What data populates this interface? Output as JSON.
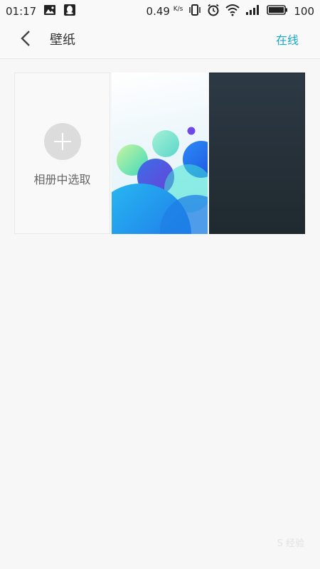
{
  "status_bar": {
    "time": "01:17",
    "speed_value": "0.49",
    "speed_unit": "K/s",
    "battery": "100",
    "icons_left": [
      "image-icon",
      "qq-notification-icon"
    ],
    "icons_right": [
      "vibrate-icon",
      "alarm-icon",
      "wifi-icon",
      "signal-icon",
      "battery-icon"
    ]
  },
  "app_bar": {
    "back_icon": "chevron-left-icon",
    "title": "壁纸",
    "action_label": "在线",
    "action_color": "#18a9c4"
  },
  "wallpapers": {
    "picker_label": "相册中选取",
    "picker_icon": "plus-icon",
    "items": [
      {
        "name": "bubbles-wallpaper",
        "style": "colorful-bubbles"
      },
      {
        "name": "dark-wallpaper",
        "style": "dark-slate"
      }
    ]
  },
  "watermark": "S 经验"
}
